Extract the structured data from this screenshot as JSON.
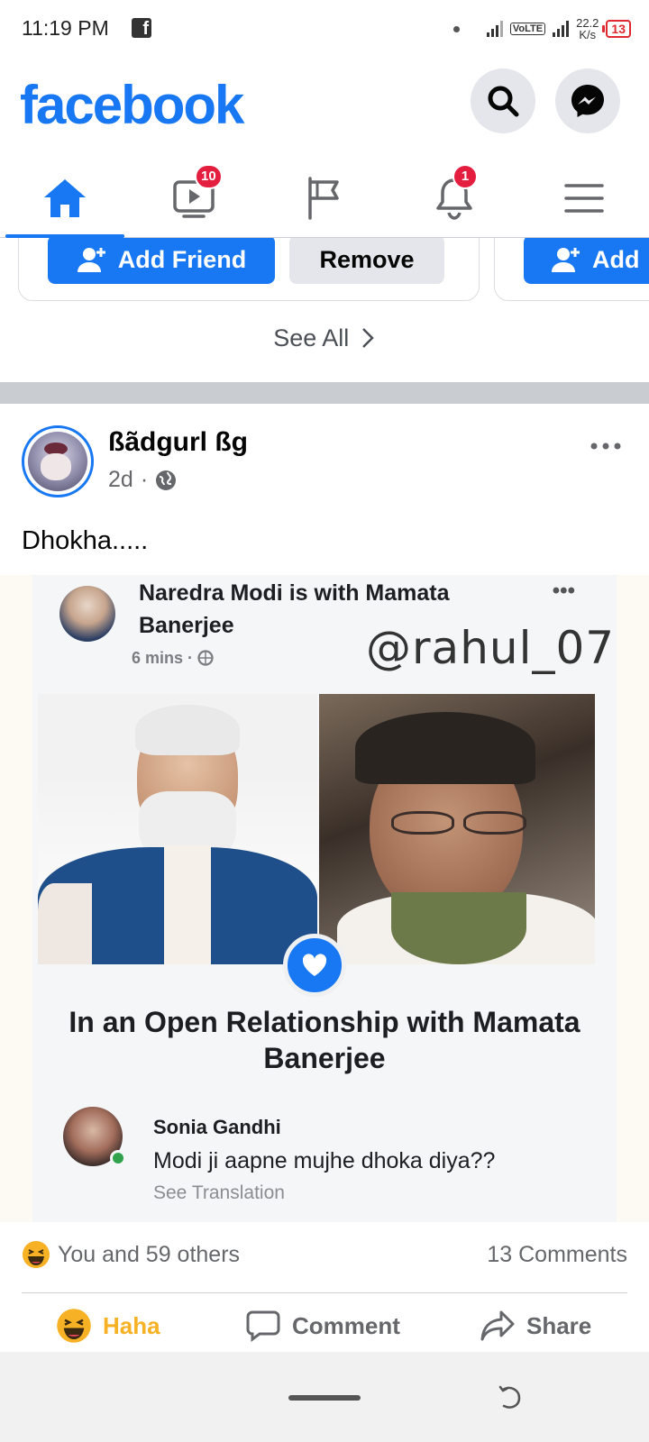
{
  "status_bar": {
    "time": "11:19 PM",
    "volte": "VoLTE",
    "speed_value": "22.2",
    "speed_unit": "K/s",
    "battery": "13"
  },
  "header": {
    "logo": "facebook",
    "search_icon": "search-icon",
    "messenger_icon": "messenger-icon"
  },
  "nav": {
    "tabs": [
      {
        "name": "home",
        "icon": "home-icon",
        "badge": ""
      },
      {
        "name": "watch",
        "icon": "video-icon",
        "badge": "10"
      },
      {
        "name": "pages",
        "icon": "flag-icon",
        "badge": ""
      },
      {
        "name": "notifications",
        "icon": "bell-icon",
        "badge": "1"
      },
      {
        "name": "menu",
        "icon": "hamburger-icon",
        "badge": ""
      }
    ],
    "active_color": "#1877f2"
  },
  "suggestions": {
    "add_friend_label": "Add Friend",
    "remove_label": "Remove",
    "add_partial_label": "Add",
    "see_all_label": "See All"
  },
  "post": {
    "author": "ßãdgurl ßg",
    "time": "2d",
    "text": "Dhokha.....",
    "image": {
      "line1": "Naredra Modi  is with Mamata",
      "line2": "Banerjee",
      "meta": "6 mins ·",
      "handle": "@rahul_07",
      "relationship_line1": "In an Open Relationship with Mamata",
      "relationship_line2": "Banerjee",
      "commenter": "Sonia Gandhi",
      "comment": "Modi ji aapne mujhe dhoka diya??",
      "see_translation": "See Translation"
    },
    "reactions_text": "You and 59 others",
    "comments_text": "13 Comments",
    "actions": {
      "haha": "Haha",
      "comment": "Comment",
      "share": "Share"
    }
  },
  "colors": {
    "brand": "#1877f2",
    "badge": "#e41e3f",
    "haha": "#f7b125"
  }
}
